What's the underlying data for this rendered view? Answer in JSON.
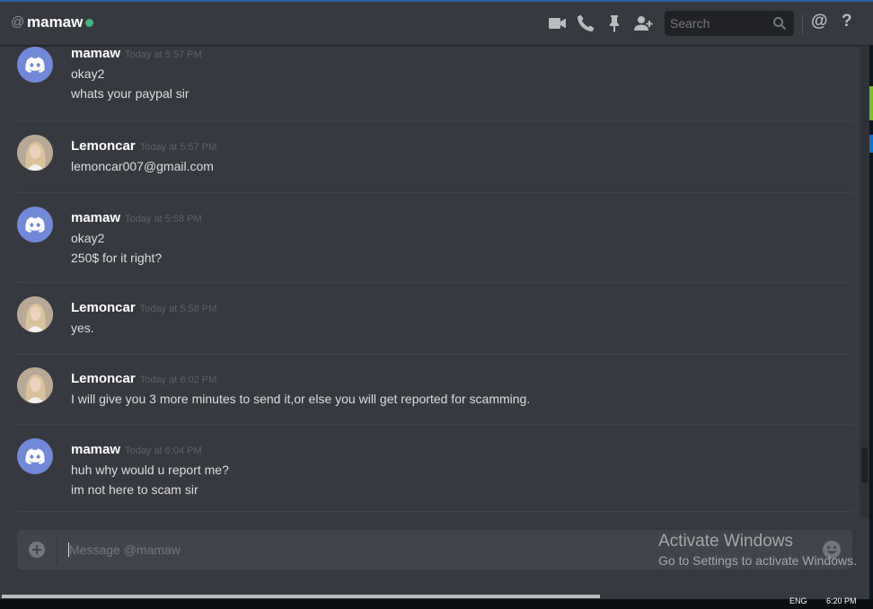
{
  "header": {
    "at_symbol": "@",
    "channel_name": "mamaw",
    "status_color": "#43b581",
    "icons": [
      "video-call-icon",
      "voice-call-icon",
      "pin-icon",
      "add-friend-icon",
      "search-icon",
      "mention-icon",
      "help-icon"
    ],
    "search_placeholder": "Search",
    "mention_symbol": "@",
    "help_symbol": "?"
  },
  "messages": [
    {
      "author": "mamaw",
      "avatar": "discord-logo-avatar",
      "time": "Today at 5:57 PM",
      "lines": [
        "okay2",
        "whats your paypal sir"
      ]
    },
    {
      "author": "Lemoncar",
      "avatar": "photo-avatar",
      "time": "Today at 5:57 PM",
      "lines": [
        "lemoncar007@gmail.com"
      ]
    },
    {
      "author": "mamaw",
      "avatar": "discord-logo-avatar",
      "time": "Today at 5:58 PM",
      "lines": [
        "okay2",
        "250$ for it right?"
      ]
    },
    {
      "author": "Lemoncar",
      "avatar": "photo-avatar",
      "time": "Today at 5:58 PM",
      "lines": [
        "yes."
      ]
    },
    {
      "author": "Lemoncar",
      "avatar": "photo-avatar",
      "time": "Today at 6:02 PM",
      "lines": [
        "I will give you 3 more minutes to send it,or else you will get reported for scamming."
      ]
    },
    {
      "author": "mamaw",
      "avatar": "discord-logo-avatar",
      "time": "Today at 6:04 PM",
      "lines": [
        "huh why would u report me?",
        "im not here to scam sir"
      ]
    }
  ],
  "composer": {
    "placeholder": "Message @mamaw",
    "value": ""
  },
  "watermark": {
    "title": "Activate Windows",
    "subtitle": "Go to Settings to activate Windows."
  },
  "taskbar": {
    "lang": "ENG",
    "time": "6:20 PM"
  },
  "colors": {
    "background": "#36393f",
    "accent": "#7289da",
    "online": "#43b581"
  }
}
